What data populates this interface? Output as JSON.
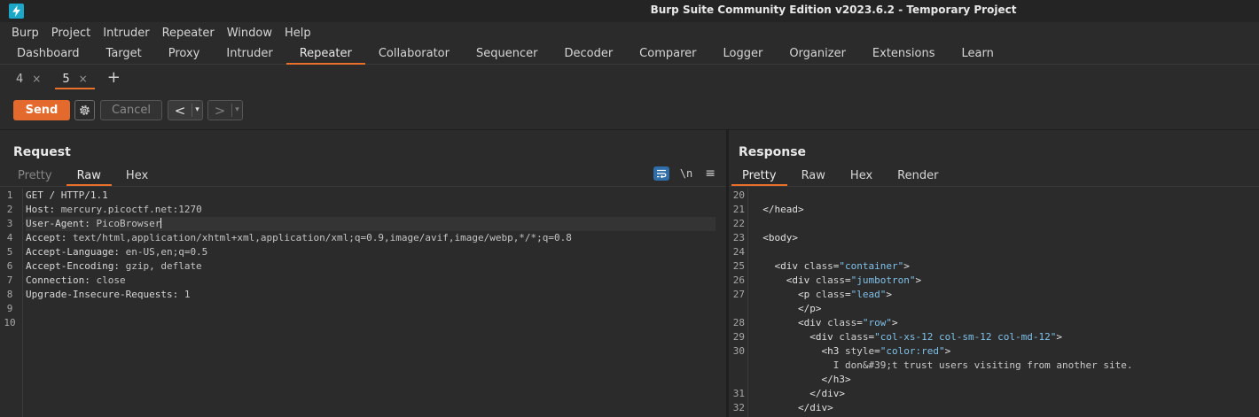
{
  "window": {
    "title": "Burp Suite Community Edition v2023.6.2 - Temporary Project",
    "logo_icon": "burp-lightning-icon"
  },
  "menu": [
    "Burp",
    "Project",
    "Intruder",
    "Repeater",
    "Window",
    "Help"
  ],
  "main_tabs": [
    {
      "label": "Dashboard",
      "active": false
    },
    {
      "label": "Target",
      "active": false
    },
    {
      "label": "Proxy",
      "active": false
    },
    {
      "label": "Intruder",
      "active": false
    },
    {
      "label": "Repeater",
      "active": true
    },
    {
      "label": "Collaborator",
      "active": false
    },
    {
      "label": "Sequencer",
      "active": false
    },
    {
      "label": "Decoder",
      "active": false
    },
    {
      "label": "Comparer",
      "active": false
    },
    {
      "label": "Logger",
      "active": false
    },
    {
      "label": "Organizer",
      "active": false
    },
    {
      "label": "Extensions",
      "active": false
    },
    {
      "label": "Learn",
      "active": false
    }
  ],
  "repeater_tabs": [
    {
      "label": "4",
      "close": "×",
      "active": false
    },
    {
      "label": "5",
      "close": "×",
      "active": true
    }
  ],
  "new_tab_label": "+",
  "actions": {
    "send_label": "Send",
    "cancel_label": "Cancel",
    "back_arrow": "<",
    "forward_arrow": ">",
    "dropdown_caret": "▾"
  },
  "request": {
    "title": "Request",
    "tabs": [
      {
        "label": "Pretty",
        "state": "dim"
      },
      {
        "label": "Raw",
        "state": "active"
      },
      {
        "label": "Hex",
        "state": "normal"
      }
    ],
    "tools": {
      "newline_label": "\\n",
      "menu_glyph": "≡"
    },
    "lines": [
      {
        "n": "1",
        "name": "GET / HTTP/1.1",
        "value": ""
      },
      {
        "n": "2",
        "name": "Host",
        "value": " mercury.picoctf.net:1270"
      },
      {
        "n": "3",
        "name": "User-Agent",
        "value": " PicoBrowser"
      },
      {
        "n": "4",
        "name": "Accept",
        "value": " text/html,application/xhtml+xml,application/xml;q=0.9,image/avif,image/webp,*/*;q=0.8"
      },
      {
        "n": "5",
        "name": "Accept-Language",
        "value": " en-US,en;q=0.5"
      },
      {
        "n": "6",
        "name": "Accept-Encoding",
        "value": " gzip, deflate"
      },
      {
        "n": "7",
        "name": "Connection",
        "value": " close"
      },
      {
        "n": "8",
        "name": "Upgrade-Insecure-Requests",
        "value": " 1"
      },
      {
        "n": "9",
        "name": "",
        "value": ""
      },
      {
        "n": "10",
        "name": "",
        "value": ""
      }
    ]
  },
  "response": {
    "title": "Response",
    "tabs": [
      {
        "label": "Pretty",
        "state": "active"
      },
      {
        "label": "Raw",
        "state": "normal"
      },
      {
        "label": "Hex",
        "state": "normal"
      },
      {
        "label": "Render",
        "state": "normal"
      }
    ],
    "lines": [
      {
        "n": "20",
        "parts": []
      },
      {
        "n": "21",
        "parts": [
          [
            "tag",
            "  </head>"
          ]
        ]
      },
      {
        "n": "22",
        "parts": []
      },
      {
        "n": "23",
        "parts": [
          [
            "tag",
            "  <body>"
          ]
        ]
      },
      {
        "n": "24",
        "parts": []
      },
      {
        "n": "25",
        "parts": [
          [
            "tag",
            "    <div "
          ],
          [
            "attr",
            "class"
          ],
          [
            "tag",
            "="
          ],
          [
            "str",
            "\"container\""
          ],
          [
            "tag",
            ">"
          ]
        ]
      },
      {
        "n": "26",
        "parts": [
          [
            "tag",
            "      <div "
          ],
          [
            "attr",
            "class"
          ],
          [
            "tag",
            "="
          ],
          [
            "str",
            "\"jumbotron\""
          ],
          [
            "tag",
            ">"
          ]
        ]
      },
      {
        "n": "27",
        "parts": [
          [
            "tag",
            "        <p "
          ],
          [
            "attr",
            "class"
          ],
          [
            "tag",
            "="
          ],
          [
            "str",
            "\"lead\""
          ],
          [
            "tag",
            ">"
          ]
        ]
      },
      {
        "n": "",
        "parts": [
          [
            "tag",
            "        </p>"
          ]
        ]
      },
      {
        "n": "28",
        "parts": [
          [
            "tag",
            "        <div "
          ],
          [
            "attr",
            "class"
          ],
          [
            "tag",
            "="
          ],
          [
            "str",
            "\"row\""
          ],
          [
            "tag",
            ">"
          ]
        ]
      },
      {
        "n": "29",
        "parts": [
          [
            "tag",
            "          <div "
          ],
          [
            "attr",
            "class"
          ],
          [
            "tag",
            "="
          ],
          [
            "str",
            "\"col-xs-12 col-sm-12 col-md-12\""
          ],
          [
            "tag",
            ">"
          ]
        ]
      },
      {
        "n": "30",
        "parts": [
          [
            "tag",
            "            <h3 "
          ],
          [
            "attr",
            "style"
          ],
          [
            "tag",
            "="
          ],
          [
            "str",
            "\"color:red\""
          ],
          [
            "tag",
            ">"
          ]
        ]
      },
      {
        "n": "",
        "parts": [
          [
            "txt",
            "              I don&#39;t trust users visiting from another site."
          ]
        ]
      },
      {
        "n": "",
        "parts": [
          [
            "tag",
            "            </h3>"
          ]
        ]
      },
      {
        "n": "31",
        "parts": [
          [
            "tag",
            "          </div>"
          ]
        ]
      },
      {
        "n": "32",
        "parts": [
          [
            "tag",
            "        </div>"
          ]
        ]
      }
    ]
  }
}
